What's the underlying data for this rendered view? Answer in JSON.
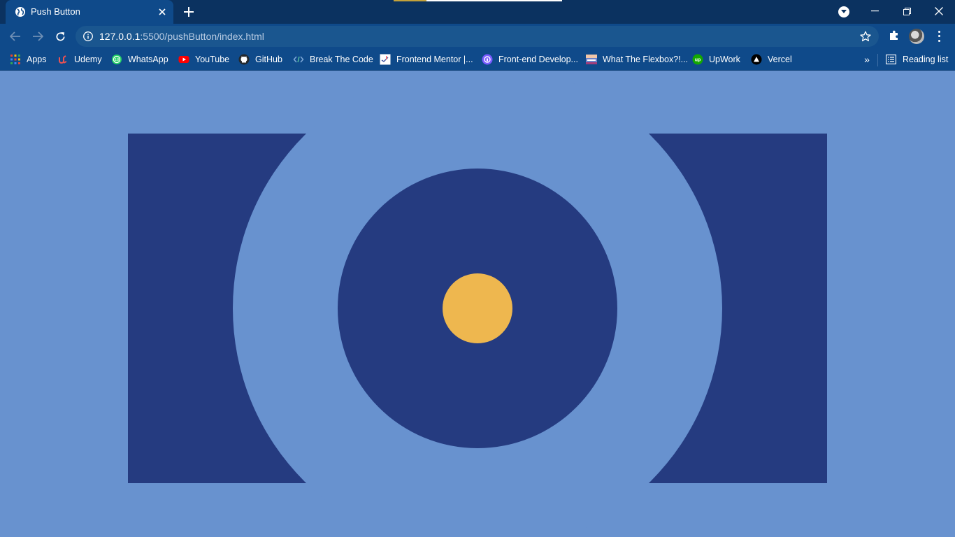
{
  "tab": {
    "title": "Push Button"
  },
  "address_bar": {
    "host": "127.0.0.1",
    "path": ":5500/pushButton/index.html"
  },
  "bookmarks": [
    {
      "label": "Apps",
      "icon": "apps-grid-icon"
    },
    {
      "label": "Udemy",
      "icon": "udemy-icon"
    },
    {
      "label": "WhatsApp",
      "icon": "whatsapp-icon"
    },
    {
      "label": "YouTube",
      "icon": "youtube-icon"
    },
    {
      "label": "GitHub",
      "icon": "github-icon"
    },
    {
      "label": "Break The Code",
      "icon": "code-icon"
    },
    {
      "label": "Frontend Mentor |...",
      "icon": "frontend-mentor-icon"
    },
    {
      "label": "Front-end Develop...",
      "icon": "frontend-dev-icon"
    },
    {
      "label": "What The Flexbox?!...",
      "icon": "flexbox-icon"
    },
    {
      "label": "UpWork",
      "icon": "upwork-icon"
    },
    {
      "label": "Vercel",
      "icon": "vercel-icon"
    }
  ],
  "reading_list": {
    "label": "Reading list"
  },
  "colors": {
    "page_background": "#6892cf",
    "shape_dark": "#253b80",
    "button_center": "#eeb74f",
    "chrome_frame": "#0b3260",
    "chrome_toolbar": "#0f4a8a"
  }
}
